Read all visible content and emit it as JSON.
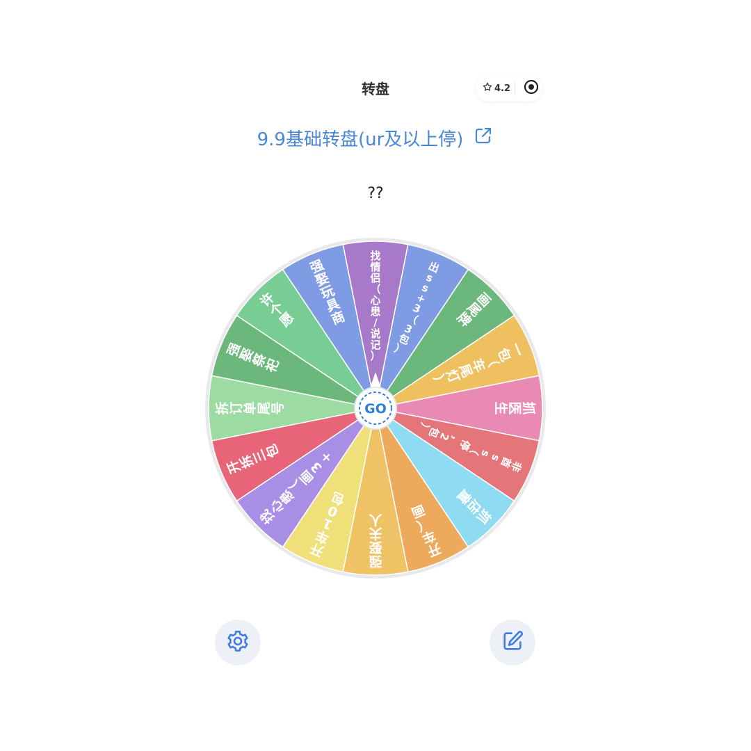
{
  "header": {
    "title": "转盘",
    "rating": "4.2",
    "rating_icon": "star-outline-icon",
    "record_icon": "target-icon"
  },
  "wheel": {
    "title": "9.9基础转盘(ur及以上停)",
    "share_icon": "share-icon",
    "result": "??",
    "go_label": "GO",
    "accent": "#2f7fd8",
    "segments": [
      {
        "label": "找情侣（心患/说记）",
        "color": "#a879c8"
      },
      {
        "label": "出ss+3（3包）",
        "color": "#7e9be3"
      },
      {
        "label": "画尾牌",
        "color": "#6cb87c"
      },
      {
        "label": "一包（车尾灯）",
        "color": "#eec060"
      },
      {
        "label": "抓医生",
        "color": "#e88ab4"
      },
      {
        "label": "非酋ss（停，2包）",
        "color": "#e47578"
      },
      {
        "label": "抓店童",
        "color": "#8fdbf2"
      },
      {
        "label": "开车（画",
        "color": "#eda95c"
      },
      {
        "label": "强娶夫人",
        "color": "#f0c266"
      },
      {
        "label": "开车10包",
        "color": "#efe07a"
      },
      {
        "label": "找心患（画3+",
        "color": "#a98ee6"
      },
      {
        "label": "开拆三包",
        "color": "#e86579"
      },
      {
        "label": "拆订单尾号",
        "color": "#9cdca2"
      },
      {
        "label": "强娶祭祀",
        "color": "#6cb87c"
      },
      {
        "label": "许个愿",
        "color": "#77cd93"
      },
      {
        "label": "强娶玩具商",
        "color": "#7e9be3"
      }
    ]
  },
  "footer": {
    "settings_icon": "gear-icon",
    "edit_icon": "edit-icon"
  }
}
